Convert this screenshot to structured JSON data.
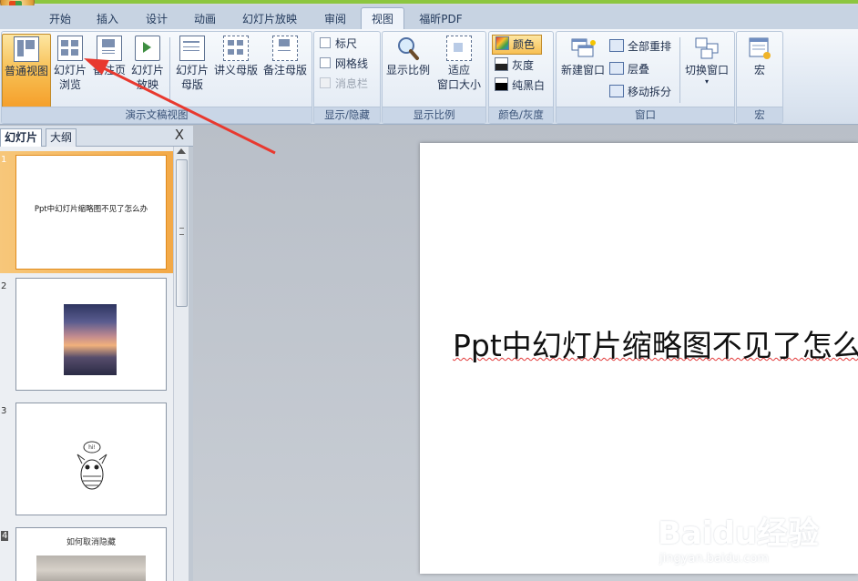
{
  "window": {
    "accent": "#8cc63f"
  },
  "tabs": [
    {
      "label": "开始"
    },
    {
      "label": "插入"
    },
    {
      "label": "设计"
    },
    {
      "label": "动画"
    },
    {
      "label": "幻灯片放映"
    },
    {
      "label": "审阅"
    },
    {
      "label": "视图"
    },
    {
      "label": "福昕PDF"
    }
  ],
  "ribbon": {
    "presentation_views": {
      "group_label": "演示文稿视图",
      "normal": "普通视图",
      "sorter_line1": "幻灯片",
      "sorter_line2": "浏览",
      "notes_page_line1": "备注页",
      "reading_line1": "幻灯片",
      "reading_line2": "放映",
      "slide_master_line1": "幻灯片",
      "slide_master_line2": "母版",
      "handout_master": "讲义母版",
      "notes_master": "备注母版"
    },
    "show_hide": {
      "group_label": "显示/隐藏",
      "ruler": "标尺",
      "gridlines": "网格线",
      "message_bar": "消息栏"
    },
    "zoom": {
      "group_label": "显示比例",
      "zoom": "显示比例",
      "fit_line1": "适应",
      "fit_line2": "窗口大小"
    },
    "color": {
      "group_label": "颜色/灰度",
      "color": "颜色",
      "grayscale": "灰度",
      "pure_bw": "纯黑白"
    },
    "window": {
      "group_label": "窗口",
      "new_window": "新建窗口",
      "arrange_all": "全部重排",
      "cascade": "层叠",
      "move_split": "移动拆分",
      "switch_windows": "切换窗口"
    },
    "macros": {
      "group_label": "宏",
      "macros": "宏"
    }
  },
  "left_panel": {
    "tab_slides": "幻灯片",
    "tab_outline": "大纲",
    "close_glyph": "X",
    "thumbnails": [
      {
        "number": "1",
        "text": "Ppt中幻灯片缩略图不见了怎么办"
      },
      {
        "number": "2",
        "text": ""
      },
      {
        "number": "3",
        "text": ""
      },
      {
        "number": "4",
        "text": "如何取消隐藏"
      }
    ],
    "bubble_text": "hi!"
  },
  "main_slide": {
    "title": "Ppt中幻灯片缩略图不见了怎么办"
  },
  "watermark": {
    "brand": "Baidu经验",
    "url": "jingyan.baidu.com"
  }
}
